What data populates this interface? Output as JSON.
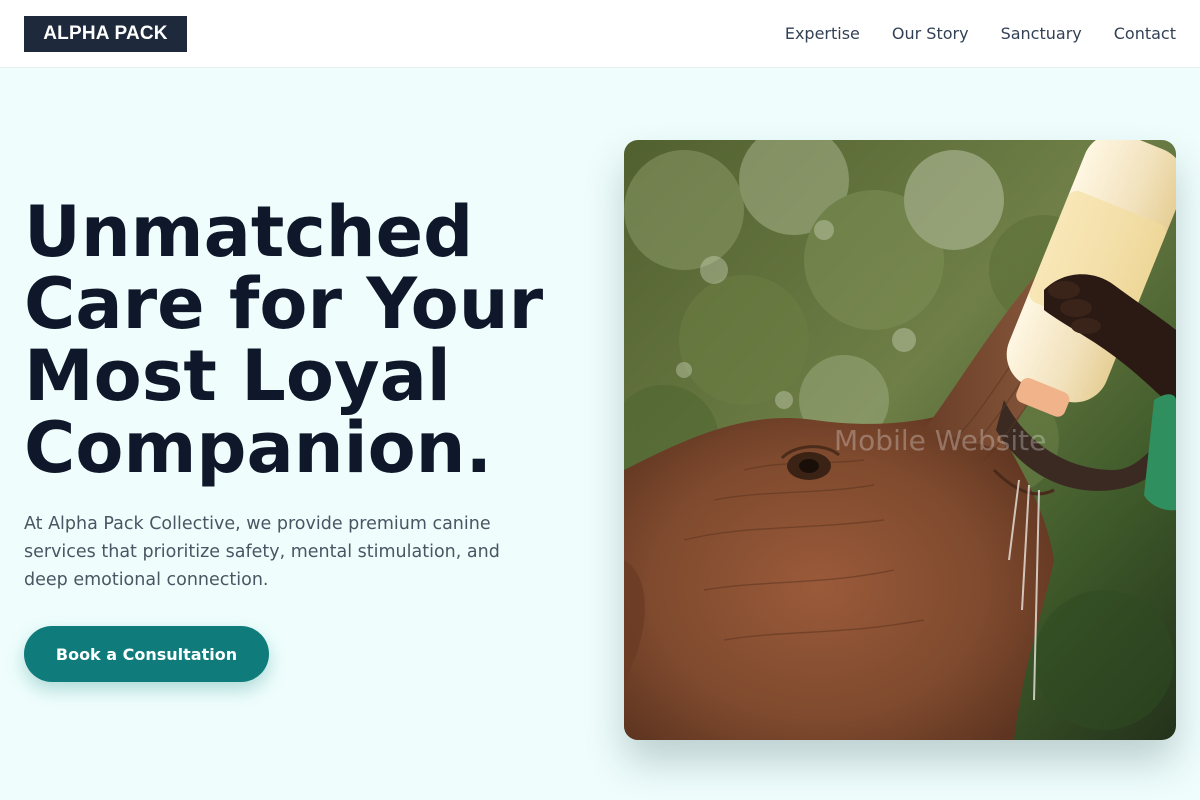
{
  "nav": {
    "logo": "ALPHA PACK",
    "links": [
      "Expertise",
      "Our Story",
      "Sanctuary",
      "Contact"
    ]
  },
  "hero": {
    "title": "Unmatched Care for Your Most Loyal Companion.",
    "subtitle": "At Alpha Pack Collective, we provide premium canine services that prioritize safety, mental stimulation, and deep emotional connection.",
    "cta_label": "Book a Consultation",
    "image_watermark": "Mobile Website"
  },
  "colors": {
    "background": "#effefd",
    "nav_background": "#ffffff",
    "logo_background": "#1e293b",
    "heading": "#0f172a",
    "body_text": "#4b5563",
    "accent": "#0f7c7b"
  },
  "icons": {
    "hero_image": "elephant-bottle-feeding-photo"
  }
}
